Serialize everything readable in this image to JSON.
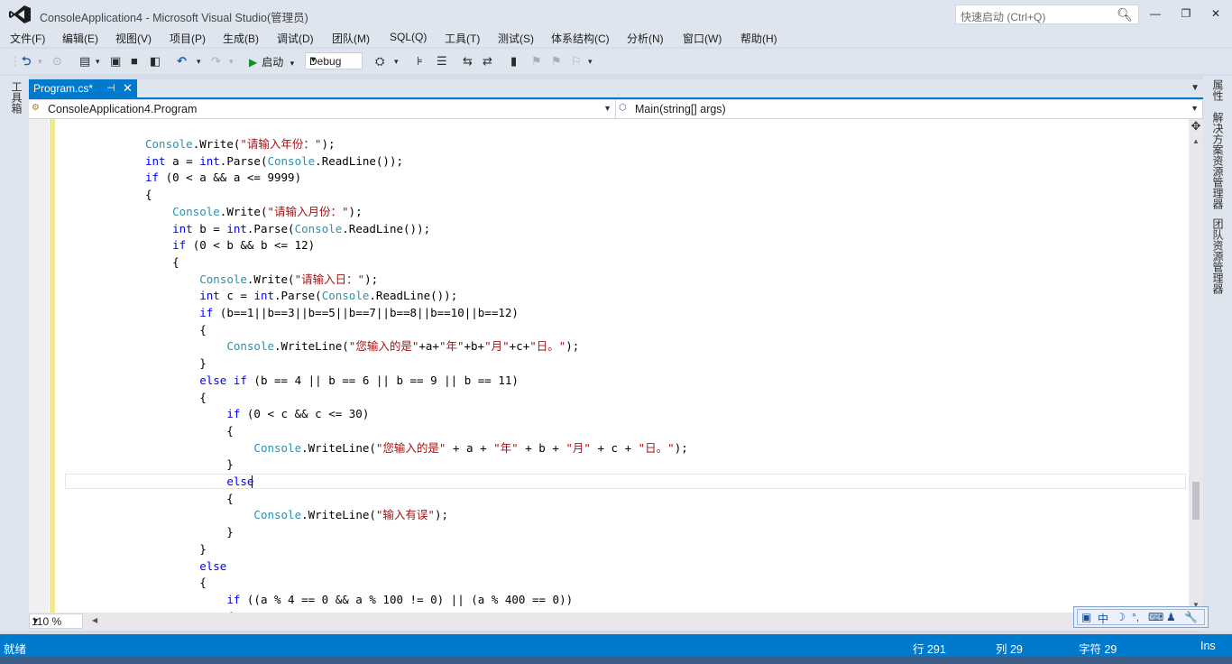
{
  "window": {
    "title": "ConsoleApplication4 - Microsoft Visual Studio(管理员)",
    "quick_launch_placeholder": "快速启动 (Ctrl+Q)",
    "minimize": "—",
    "restore": "❐",
    "close": "✕"
  },
  "menu": [
    "文件(F)",
    "编辑(E)",
    "视图(V)",
    "项目(P)",
    "生成(B)",
    "调试(D)",
    "团队(M)",
    "SQL(Q)",
    "工具(T)",
    "测试(S)",
    "体系结构(C)",
    "分析(N)",
    "窗口(W)",
    "帮助(H)"
  ],
  "toolbar": {
    "start_label": "启动",
    "config": "Debug"
  },
  "side": {
    "toolbox": "工具箱",
    "properties": "属性",
    "solution_explorer": "解决方案资源管理器",
    "team_explorer": "团队资源管理器"
  },
  "doc_tab": {
    "name": "Program.cs*",
    "pin": "⊣",
    "close": "✕"
  },
  "navbar": {
    "class_combo": "ConsoleApplication4.Program",
    "member_combo": "Main(string[] args)"
  },
  "editor": {
    "lines": [
      [
        [
          "ty",
          "Console"
        ],
        [
          "n",
          "."
        ],
        [
          "n",
          "Write"
        ],
        [
          "n",
          "("
        ],
        [
          "st",
          "\"请输入年份：\""
        ],
        [
          "n",
          ");"
        ]
      ],
      [
        [
          "kw",
          "int"
        ],
        [
          "n",
          " a = "
        ],
        [
          "kw",
          "int"
        ],
        [
          "n",
          ".Parse("
        ],
        [
          "ty",
          "Console"
        ],
        [
          "n",
          ".ReadLine());"
        ]
      ],
      [
        [
          "kw",
          "if"
        ],
        [
          "n",
          " (0 < a && a <= 9999)"
        ]
      ],
      [
        [
          "n",
          "{"
        ]
      ],
      [
        [
          "n",
          "    "
        ],
        [
          "ty",
          "Console"
        ],
        [
          "n",
          ".Write("
        ],
        [
          "st",
          "\"请输入月份：\""
        ],
        [
          "n",
          ");"
        ]
      ],
      [
        [
          "n",
          "    "
        ],
        [
          "kw",
          "int"
        ],
        [
          "n",
          " b = "
        ],
        [
          "kw",
          "int"
        ],
        [
          "n",
          ".Parse("
        ],
        [
          "ty",
          "Console"
        ],
        [
          "n",
          ".ReadLine());"
        ]
      ],
      [
        [
          "n",
          "    "
        ],
        [
          "kw",
          "if"
        ],
        [
          "n",
          " (0 < b && b <= 12)"
        ]
      ],
      [
        [
          "n",
          "    {"
        ]
      ],
      [
        [
          "n",
          "        "
        ],
        [
          "ty",
          "Console"
        ],
        [
          "n",
          ".Write("
        ],
        [
          "st",
          "\"请输入日：\""
        ],
        [
          "n",
          ");"
        ]
      ],
      [
        [
          "n",
          "        "
        ],
        [
          "kw",
          "int"
        ],
        [
          "n",
          " c = "
        ],
        [
          "kw",
          "int"
        ],
        [
          "n",
          ".Parse("
        ],
        [
          "ty",
          "Console"
        ],
        [
          "n",
          ".ReadLine());"
        ]
      ],
      [
        [
          "n",
          "        "
        ],
        [
          "kw",
          "if"
        ],
        [
          "n",
          " (b==1||b==3||b==5||b==7||b==8||b==10||b==12)"
        ]
      ],
      [
        [
          "n",
          "        {"
        ]
      ],
      [
        [
          "n",
          "            "
        ],
        [
          "ty",
          "Console"
        ],
        [
          "n",
          ".WriteLine("
        ],
        [
          "st",
          "\"您输入的是\""
        ],
        [
          "n",
          "+a+"
        ],
        [
          "st",
          "\"年\""
        ],
        [
          "n",
          "+b+"
        ],
        [
          "st",
          "\"月\""
        ],
        [
          "n",
          "+c+"
        ],
        [
          "st",
          "\"日。\""
        ],
        [
          "n",
          ");"
        ]
      ],
      [
        [
          "n",
          "        }"
        ]
      ],
      [
        [
          "n",
          "        "
        ],
        [
          "kw",
          "else if"
        ],
        [
          "n",
          " (b == 4 || b == 6 || b == 9 || b == 11)"
        ]
      ],
      [
        [
          "n",
          "        {"
        ]
      ],
      [
        [
          "n",
          "            "
        ],
        [
          "kw",
          "if"
        ],
        [
          "n",
          " (0 < c && c <= 30)"
        ]
      ],
      [
        [
          "n",
          "            {"
        ]
      ],
      [
        [
          "n",
          "                "
        ],
        [
          "ty",
          "Console"
        ],
        [
          "n",
          ".WriteLine("
        ],
        [
          "st",
          "\"您输入的是\""
        ],
        [
          "n",
          " + a + "
        ],
        [
          "st",
          "\"年\""
        ],
        [
          "n",
          " + b + "
        ],
        [
          "st",
          "\"月\""
        ],
        [
          "n",
          " + c + "
        ],
        [
          "st",
          "\"日。\""
        ],
        [
          "n",
          ");"
        ]
      ],
      [
        [
          "n",
          "            }"
        ]
      ],
      [
        [
          "n",
          "            "
        ],
        [
          "kw",
          "else"
        ]
      ],
      [
        [
          "n",
          "            {"
        ]
      ],
      [
        [
          "n",
          "                "
        ],
        [
          "ty",
          "Console"
        ],
        [
          "n",
          ".WriteLine("
        ],
        [
          "st",
          "\"输入有误\""
        ],
        [
          "n",
          ");"
        ]
      ],
      [
        [
          "n",
          "            }"
        ]
      ],
      [
        [
          "n",
          "        }"
        ]
      ],
      [
        [
          "n",
          "        "
        ],
        [
          "kw",
          "else"
        ]
      ],
      [
        [
          "n",
          "        {"
        ]
      ],
      [
        [
          "n",
          "            "
        ],
        [
          "kw",
          "if"
        ],
        [
          "n",
          " ((a % 4 == 0 && a % 100 != 0) || (a % 400 == 0))"
        ]
      ],
      [
        [
          "n",
          "            {"
        ]
      ]
    ]
  },
  "zoom": "110 %",
  "ime": [
    "中",
    "☽",
    "°,",
    "⌨",
    "♟",
    "🔧"
  ],
  "status": {
    "ready": "就绪",
    "line": "行 291",
    "col": "列 29",
    "char": "字符 29",
    "ins": "Ins"
  },
  "colors": {
    "accent": "#007acc",
    "chrome": "#dfe5ef",
    "keyword": "#0000ff",
    "type": "#2b91af",
    "string": "#a31515"
  }
}
